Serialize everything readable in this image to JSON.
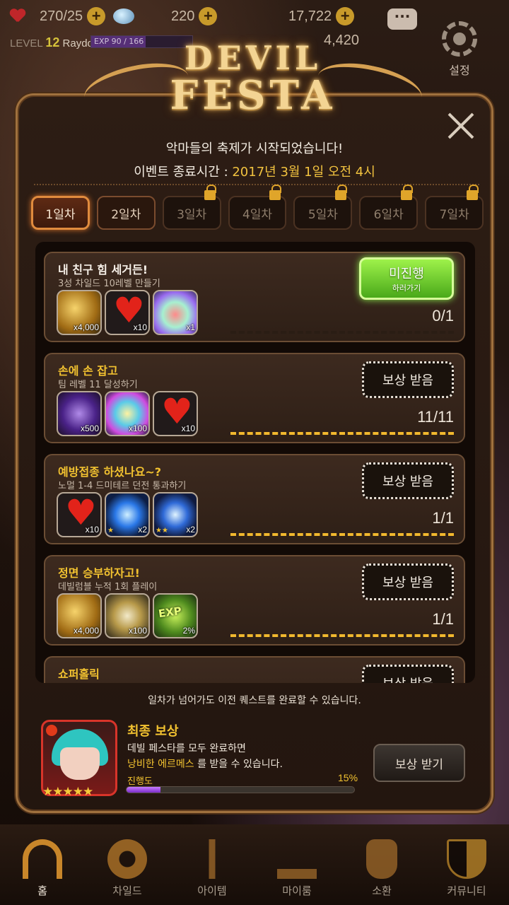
{
  "topbar": {
    "hearts": "270/25",
    "gems": "220",
    "gold": "17,722",
    "gold2": "4,420",
    "level_label": "LEVEL",
    "level": "12",
    "player_name": "Raydo",
    "exp_text": "EXP 90 / 166",
    "exp_fraction": 0.54,
    "chat_glyph": "···",
    "settings_label": "설정"
  },
  "banner": {
    "line1": "DEVIL",
    "line2": "FESTA"
  },
  "headline": "악마들의 축제가 시작되었습니다!",
  "end_time": {
    "label": "이벤트 종료시간 : ",
    "value": "2017년 3월 1일 오전 4시"
  },
  "tabs": [
    {
      "label": "1일차",
      "state": "active"
    },
    {
      "label": "2일차",
      "state": "open"
    },
    {
      "label": "3일차",
      "state": "locked"
    },
    {
      "label": "4일차",
      "state": "locked"
    },
    {
      "label": "5일차",
      "state": "locked"
    },
    {
      "label": "6일차",
      "state": "locked"
    },
    {
      "label": "7일차",
      "state": "locked"
    }
  ],
  "quests": [
    {
      "title": "내 친구 힘 세거든!",
      "title_style": "white",
      "desc": "3성 차일드 10레벨 만들기",
      "items": [
        {
          "icon": "gold-coins-icon",
          "kind": "i-coin",
          "count": "x4,000",
          "stars": ""
        },
        {
          "icon": "heart-icon",
          "kind": "i-heart",
          "count": "x10",
          "stars": ""
        },
        {
          "icon": "rainbow-drop-icon",
          "kind": "i-drop",
          "count": "x1",
          "stars": ""
        }
      ],
      "button": "미진행",
      "button_sub": "하러가기",
      "button_style": "go",
      "progress": "0/1",
      "done": false
    },
    {
      "title": "손에 손 잡고",
      "title_style": "gold",
      "desc": "팀 레벨 11 달성하기",
      "items": [
        {
          "icon": "purple-crystal-icon",
          "kind": "i-purple",
          "count": "x500",
          "stars": ""
        },
        {
          "icon": "prism-orb-icon",
          "kind": "i-orb",
          "count": "x100",
          "stars": ""
        },
        {
          "icon": "heart-icon",
          "kind": "i-heart",
          "count": "x10",
          "stars": ""
        }
      ],
      "button": "보상 받음",
      "button_sub": "",
      "button_style": "claimed",
      "progress": "11/11",
      "done": true
    },
    {
      "title": "예방접종 하셨나요~?",
      "title_style": "gold",
      "desc": "노멀 1-4 드미테르 던전 통과하기",
      "items": [
        {
          "icon": "heart-icon",
          "kind": "i-heart",
          "count": "x10",
          "stars": ""
        },
        {
          "icon": "blue-gem-icon",
          "kind": "i-blue1",
          "count": "x2",
          "stars": "★"
        },
        {
          "icon": "blue-gem-icon",
          "kind": "i-blue2",
          "count": "x2",
          "stars": "★★"
        }
      ],
      "button": "보상 받음",
      "button_sub": "",
      "button_style": "claimed",
      "progress": "1/1",
      "done": true
    },
    {
      "title": "정면 승부하자고!",
      "title_style": "gold",
      "desc": "데빌럼블 누적 1회 플레이",
      "items": [
        {
          "icon": "gold-coins-icon",
          "kind": "i-coin",
          "count": "x4,000",
          "stars": ""
        },
        {
          "icon": "silver-coin-icon",
          "kind": "i-silver",
          "count": "x100",
          "stars": ""
        },
        {
          "icon": "user-exp-icon",
          "kind": "i-exp",
          "count": "2%",
          "stars": "",
          "label": "EXP"
        }
      ],
      "button": "보상 받음",
      "button_sub": "",
      "button_style": "claimed",
      "progress": "1/1",
      "done": true
    },
    {
      "title": "쇼퍼홀릭",
      "title_style": "gold",
      "desc": "",
      "items": [],
      "button": "보상 받음",
      "button_sub": "",
      "button_style": "claimed",
      "progress": "",
      "done": true
    }
  ],
  "tip": "일차가 넘어가도 이전 퀘스트를 완료할 수 있습니다.",
  "final_reward": {
    "title": "최종 보상",
    "line1": "데빌 페스타를 모두 완료하면",
    "reward_name": "낭비한 에르메스",
    "line2_rest": " 를 받을 수 있습니다.",
    "progress_label": "진행도",
    "progress_text": "15%",
    "progress_fraction": 0.15,
    "stars": "★★★★★",
    "claim_label": "보상 받기"
  },
  "nav": [
    {
      "label": "홈",
      "icon": "home-icon",
      "cls": "n-home",
      "active": true
    },
    {
      "label": "차일드",
      "icon": "child-icon",
      "cls": "n-child",
      "active": false
    },
    {
      "label": "아이템",
      "icon": "item-icon",
      "cls": "n-item",
      "active": false
    },
    {
      "label": "마이룸",
      "icon": "myroom-icon",
      "cls": "n-myroom",
      "active": false
    },
    {
      "label": "소환",
      "icon": "summon-icon",
      "cls": "n-summon",
      "active": false
    },
    {
      "label": "커뮤니티",
      "icon": "community-icon",
      "cls": "n-comm",
      "active": false
    }
  ],
  "close_icon": "close-icon"
}
